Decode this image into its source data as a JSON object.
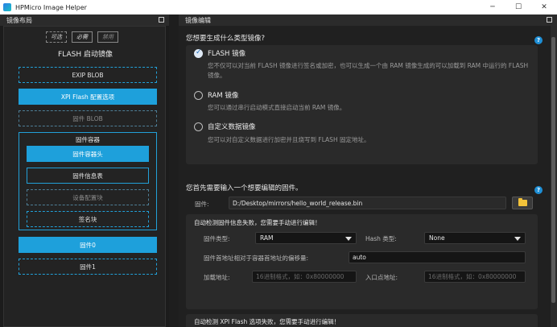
{
  "window": {
    "title": "HPMicro Image Helper",
    "min_glyph": "─",
    "max_glyph": "☐",
    "close_glyph": "✕"
  },
  "left_panel": {
    "header": "镜像布局",
    "legend": {
      "optional": "可选",
      "required": "必需",
      "disabled": "禁用"
    },
    "title": "FLASH 启动镜像",
    "blocks": {
      "exip_blob": "EXIP BLOB",
      "xpi_flash": "XPI Flash 配置选项",
      "fw_blob": "固件 BLOB"
    },
    "container": {
      "title": "固件容器",
      "header": "固件容器头",
      "info_table": "固件信息表",
      "device_config": "设备配置块",
      "signature": "签名块"
    },
    "firmware0": "固件0",
    "firmware1": "固件1"
  },
  "right_panel": {
    "header": "镜像编辑",
    "question1": "您想要生成什么类型镜像?",
    "help_glyph": "?",
    "options": [
      {
        "label": "FLASH 镜像",
        "desc": "您不仅可以对当前 FLASH 镜像进行签名或加密，也可以生成一个由 RAM 镜像生成的可以加载到 RAM 中运行的 FLASH 镜像。",
        "selected": true
      },
      {
        "label": "RAM 镜像",
        "desc": "您可以通过串行启动模式直接启动当前 RAM 镜像。",
        "selected": false
      },
      {
        "label": "自定义数据镜像",
        "desc": "您可以对自定义数据进行加密并且烧写到 FLASH 固定地址。",
        "selected": false
      }
    ],
    "question2": "您首先需要输入一个想要编辑的固件。",
    "firmware_label": "固件:",
    "firmware_path": "D:/Desktop/mirrors/hello_world_release.bin",
    "folder_icon": "folder-icon",
    "detect_fail_fw": "自动检测固件信息失败，您需要手动进行编辑！",
    "fw_type_label": "固件类型:",
    "fw_type_value": "RAM",
    "hash_type_label": "Hash 类型:",
    "hash_type_value": "None",
    "offset_label": "固件首地址相对于容器首地址的偏移量:",
    "offset_value": "auto",
    "load_addr_label": "加载地址:",
    "load_addr_placeholder": "16进制格式，如：0x80000000",
    "entry_addr_label": "入口点地址:",
    "entry_addr_placeholder": "16进制格式，如：0x80000000",
    "detect_fail_xpi": "自动检测 XPI Flash 选项失败，您需要手动进行编辑！"
  },
  "colors": {
    "accent": "#1ea0db",
    "help": "#1e8fd6",
    "background": "#1e1e1e"
  }
}
